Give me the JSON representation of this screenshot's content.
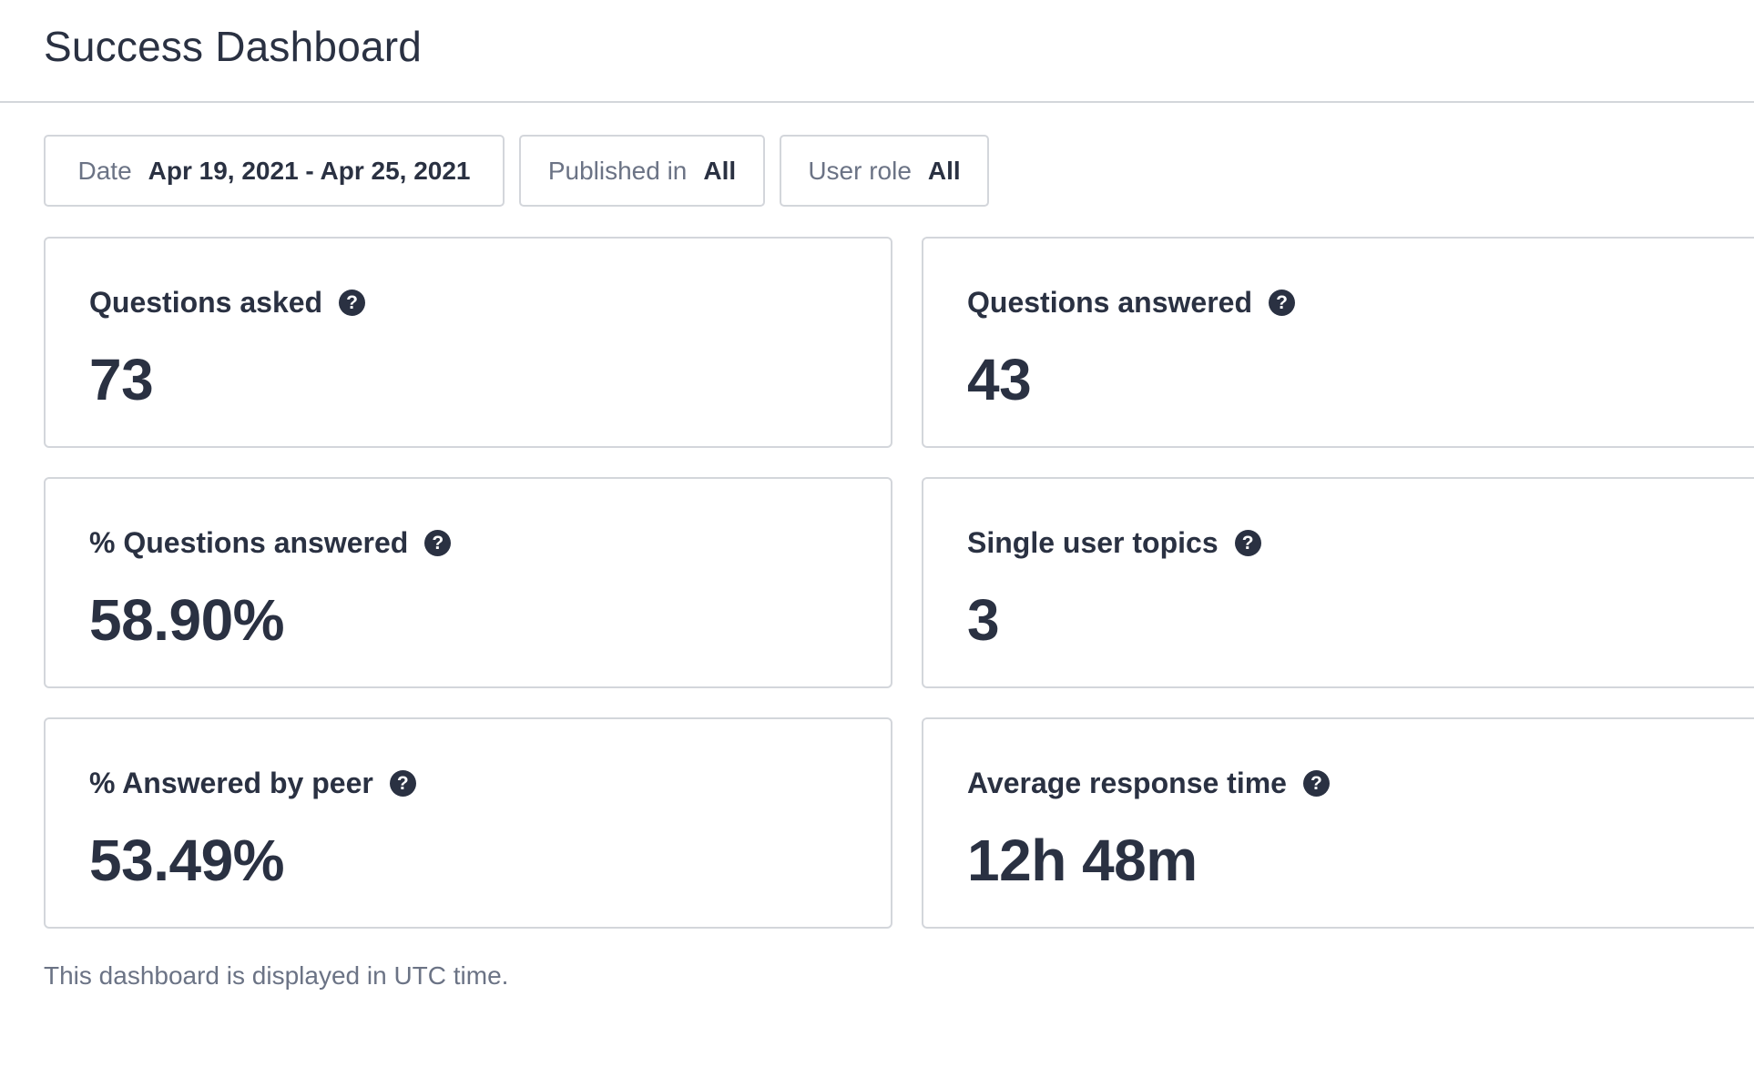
{
  "header": {
    "title": "Success Dashboard"
  },
  "filters": [
    {
      "label": "Date",
      "value": "Apr 19, 2021 - Apr 25, 2021"
    },
    {
      "label": "Published in",
      "value": "All"
    },
    {
      "label": "User role",
      "value": "All"
    }
  ],
  "cards": [
    {
      "title": "Questions asked",
      "value": "73",
      "icon": "question-circle-icon"
    },
    {
      "title": "Questions answered",
      "value": "43",
      "icon": "question-circle-icon"
    },
    {
      "title": "% Questions answered",
      "value": "58.90%",
      "icon": "question-circle-icon"
    },
    {
      "title": "Single user topics",
      "value": "3",
      "icon": "question-circle-icon"
    },
    {
      "title": "% Answered by peer",
      "value": "53.49%",
      "icon": "question-circle-icon"
    },
    {
      "title": "Average response time",
      "value": "12h 48m",
      "icon": "question-circle-icon"
    }
  ],
  "help_icon_glyph": "?",
  "footer": {
    "note": "This dashboard is displayed in UTC time."
  },
  "colors": {
    "text_primary": "#2a3142",
    "text_secondary": "#6b7385",
    "border": "#d3d6db",
    "background": "#ffffff"
  }
}
